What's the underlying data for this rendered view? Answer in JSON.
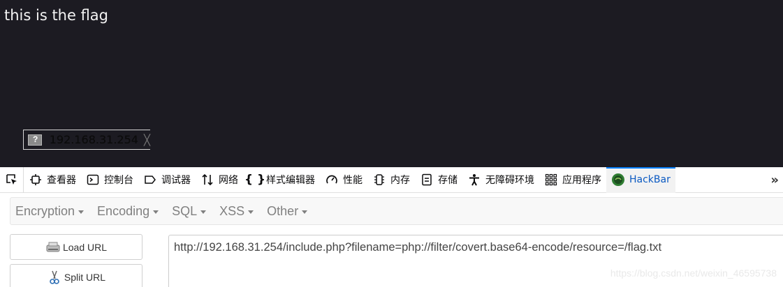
{
  "page": {
    "text": "this is the flag",
    "status_tip": {
      "text": "192.168.31.254",
      "close_glyph": "╳"
    }
  },
  "devtools": {
    "tabs": [
      {
        "label": "查看器",
        "icon": "inspector-icon"
      },
      {
        "label": "控制台",
        "icon": "console-icon"
      },
      {
        "label": "调试器",
        "icon": "debugger-icon"
      },
      {
        "label": "网络",
        "icon": "network-icon"
      },
      {
        "label": "样式编辑器",
        "icon": "style-editor-icon"
      },
      {
        "label": "性能",
        "icon": "performance-icon"
      },
      {
        "label": "内存",
        "icon": "memory-icon"
      },
      {
        "label": "存储",
        "icon": "storage-icon"
      },
      {
        "label": "无障碍环境",
        "icon": "accessibility-icon"
      },
      {
        "label": "应用程序",
        "icon": "application-icon"
      },
      {
        "label": "HackBar",
        "icon": "hackbar-icon",
        "active": true
      }
    ],
    "more_glyph": "»"
  },
  "hackbar": {
    "menu": [
      {
        "label": "Encryption"
      },
      {
        "label": "Encoding"
      },
      {
        "label": "SQL"
      },
      {
        "label": "XSS"
      },
      {
        "label": "Other"
      }
    ],
    "load_url_label": "Load URL",
    "split_url_label": "Split URL",
    "url": "http://192.168.31.254/include.php?filename=php://filter/covert.base64-encode/resource=/flag.txt"
  },
  "watermark": "https://blog.csdn.net/weixin_46595738",
  "colors": {
    "page_bg": "#1c1b22",
    "accent": "#0a84ff",
    "active_tab_text": "#0a59c2"
  }
}
